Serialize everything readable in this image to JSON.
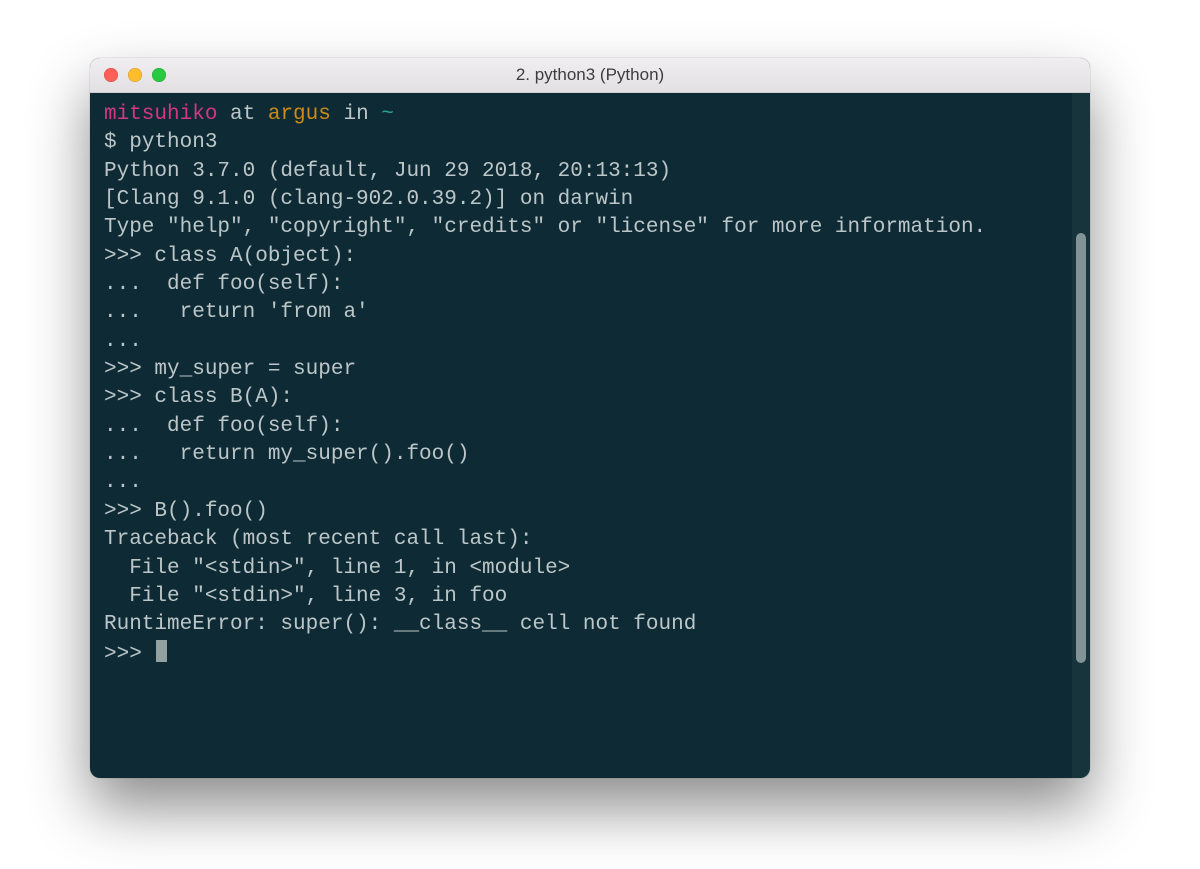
{
  "window": {
    "title": "2. python3 (Python)"
  },
  "prompt": {
    "user": "mitsuhiko",
    "at": " at ",
    "host": "argus",
    "in": " in ",
    "cwd": "~"
  },
  "lines": {
    "cmd_line_prefix": "$ ",
    "cmd": "python3",
    "banner1": "Python 3.7.0 (default, Jun 29 2018, 20:13:13)",
    "banner2": "[Clang 9.1.0 (clang-902.0.39.2)] on darwin",
    "banner3": "Type \"help\", \"copyright\", \"credits\" or \"license\" for more information.",
    "l1": ">>> class A(object):",
    "l2": "...  def foo(self):",
    "l3": "...   return 'from a'",
    "l4": "...",
    "l5": ">>> my_super = super",
    "l6": ">>> class B(A):",
    "l7": "...  def foo(self):",
    "l8": "...   return my_super().foo()",
    "l9": "...",
    "l10": ">>> B().foo()",
    "tb1": "Traceback (most recent call last):",
    "tb2": "  File \"<stdin>\", line 1, in <module>",
    "tb3": "  File \"<stdin>\", line 3, in foo",
    "err": "RuntimeError: super(): __class__ cell not found",
    "final_prompt": ">>> "
  }
}
